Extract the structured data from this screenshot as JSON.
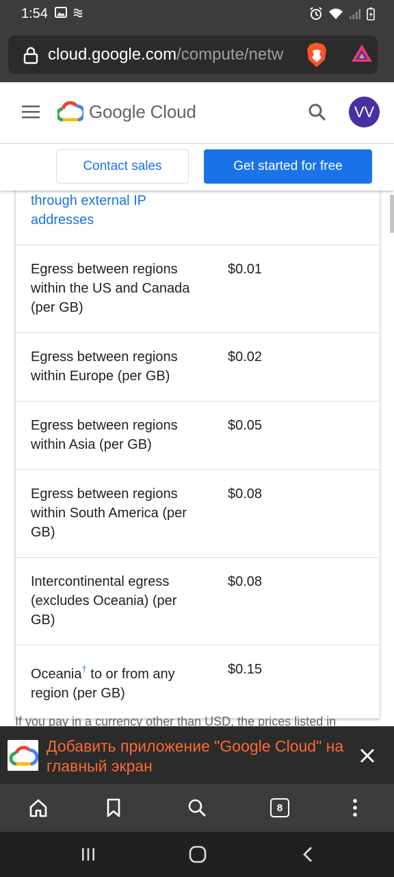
{
  "status_bar": {
    "time": "1:54"
  },
  "browser": {
    "url_host": "cloud.google.com",
    "url_path": "/compute/netw",
    "tab_count": "8"
  },
  "header": {
    "brand": "Google Cloud",
    "avatar_initials": "VV"
  },
  "cta": {
    "contact_label": "Contact sales",
    "start_label": "Get started for free"
  },
  "pricing": {
    "partial_row_label": "through external IP addresses",
    "rows": [
      {
        "label": "Egress between regions within the US and Canada (per GB)",
        "price": "$0.01"
      },
      {
        "label": "Egress between regions within Europe (per GB)",
        "price": "$0.02"
      },
      {
        "label": "Egress between regions within Asia (per GB)",
        "price": "$0.05"
      },
      {
        "label": "Egress between regions within South America (per GB)",
        "price": "$0.08"
      },
      {
        "label": "Intercontinental egress (excludes Oceania) (per GB)",
        "price": "$0.08"
      },
      {
        "label_main": "Oceania",
        "label_mark": "†",
        "label_rest": " to or from any region (per GB)",
        "price": "$0.15"
      }
    ]
  },
  "footnote": "If you pay in a currency other than USD, the prices listed in",
  "install_banner": {
    "text": "Добавить приложение \"Google Cloud\" на главный экран"
  },
  "colors": {
    "accent": "#1a73e8",
    "avatar": "#4a2fa3",
    "banner_text": "#ff6a33",
    "chrome": "#3c3c3c"
  }
}
